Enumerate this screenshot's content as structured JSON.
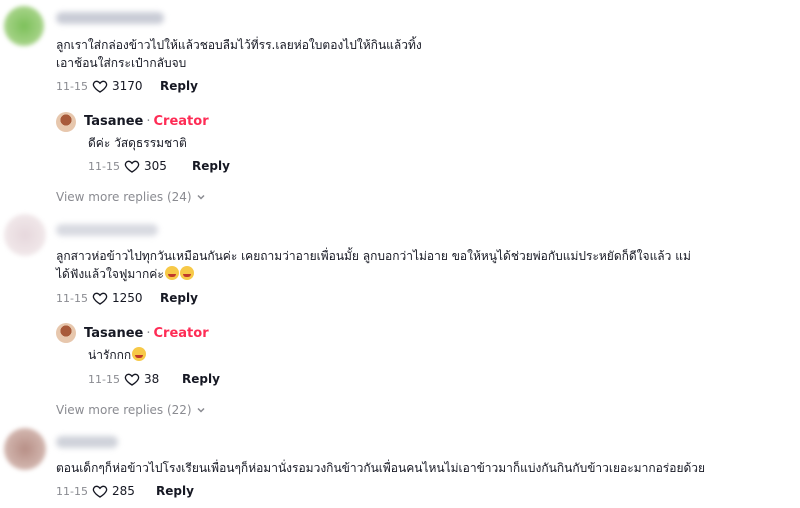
{
  "comments": [
    {
      "text_lines": [
        "ลูกเราใส่กล่องข้าวไปให้แล้วชอบลืมไว้ที่รร.เลยห่อใบตองไปให้กินแล้วทิ้ง",
        "เอาช้อนใส่กระเป๋ากลับจบ"
      ],
      "date": "11-15",
      "likes": "3170",
      "reply_label": "Reply",
      "creator_reply": {
        "username": "Tasanee",
        "badge": "Creator",
        "text": "ดีค่ะ วัสดุธรรมชาติ",
        "date": "11-15",
        "likes": "305",
        "reply_label": "Reply"
      },
      "view_more": "View more replies (24)"
    },
    {
      "text_lines": [
        "ลูกสาวห่อข้าวไปทุกวันเหมือนกันค่ะ เคยถามว่าอายเพื่อนมั้ย ลูกบอกว่าไม่อาย ขอให้หนูได้ช่วยพ่อกับแม่ประหยัดก็ดีใจแล้ว แม่",
        "ได้ฟังแล้วใจฟูมากค่ะ"
      ],
      "date": "11-15",
      "likes": "1250",
      "reply_label": "Reply",
      "creator_reply": {
        "username": "Tasanee",
        "badge": "Creator",
        "text": "น่ารักกก",
        "date": "11-15",
        "likes": "38",
        "reply_label": "Reply"
      },
      "view_more": "View more replies (22)"
    },
    {
      "text_lines": [
        "ตอนเด็กๆก็ห่อข้าวไปโรงเรียนเพื่อนๆก็ห่อมานั่งรอมวงกินข้าวกันเพื่อนคนไหนไม่เอาข้าวมาก็แบ่งกันกินกับข้าวเยอะมากอร่อยด้วย"
      ],
      "date": "11-15",
      "likes": "285",
      "reply_label": "Reply"
    }
  ],
  "colors": {
    "creator_badge": "#fe2c55",
    "meta": "#8a8b91",
    "text": "#161823"
  }
}
